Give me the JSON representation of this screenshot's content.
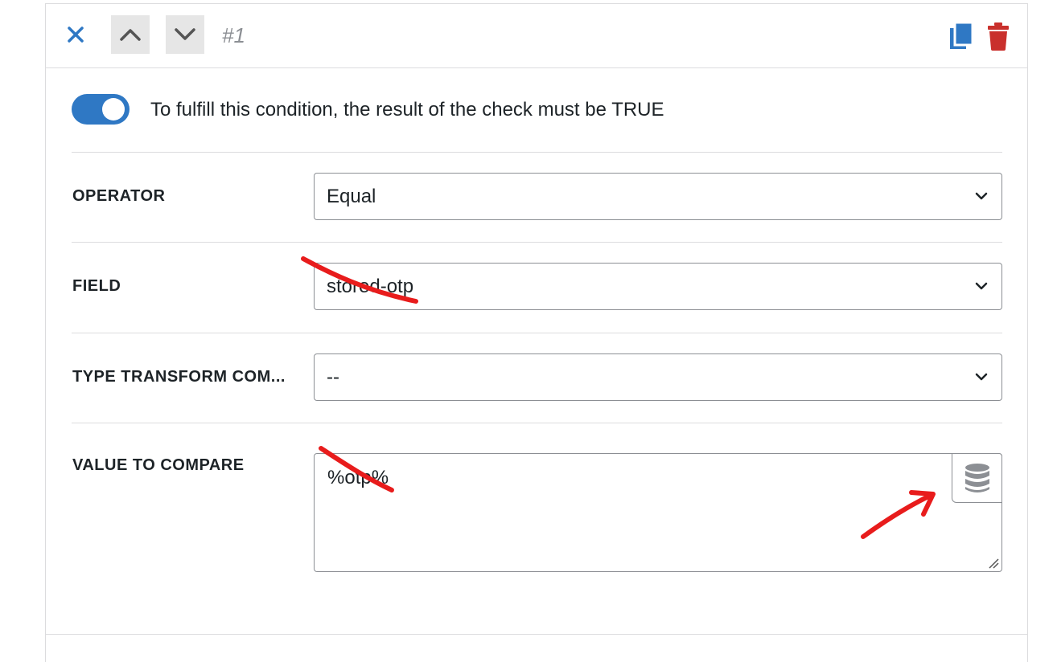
{
  "header": {
    "index_label": "#1"
  },
  "toggle": {
    "label": "To fulfill this condition, the result of the check must be TRUE",
    "state": "on"
  },
  "rows": {
    "operator": {
      "label": "OPERATOR",
      "value": "Equal"
    },
    "field": {
      "label": "FIELD",
      "value": "stored-otp"
    },
    "type_transform": {
      "label": "TYPE TRANSFORM COM...",
      "value": "--"
    },
    "value_to_compare": {
      "label": "VALUE TO COMPARE",
      "value": "%otp%"
    }
  },
  "icons": {
    "close": "close-icon",
    "up": "chevron-up-icon",
    "down": "chevron-down-icon",
    "copy": "copy-icon",
    "delete": "trash-icon",
    "database": "database-icon"
  },
  "colors": {
    "accent": "#2f78c4",
    "danger": "#c9302c",
    "annotation": "#e81c1c"
  }
}
